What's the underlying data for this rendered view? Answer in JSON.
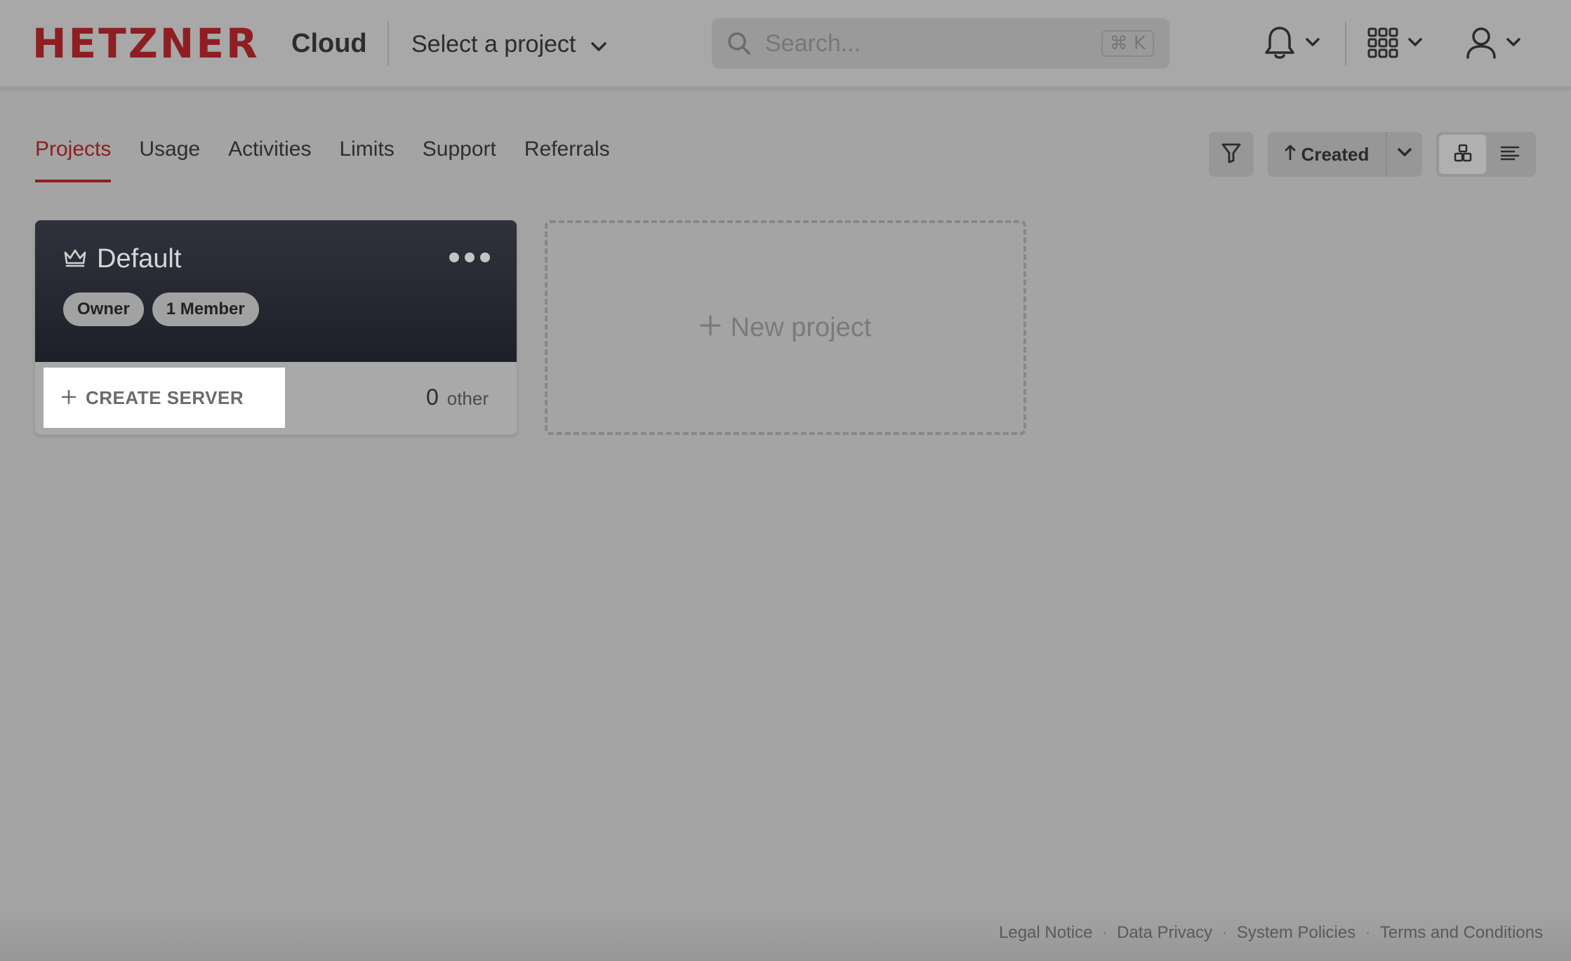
{
  "header": {
    "brand": "HETZNER",
    "product": "Cloud",
    "project_select_label": "Select a project",
    "search": {
      "placeholder": "Search...",
      "shortcut": "⌘ K"
    },
    "icons": [
      "bell-icon",
      "apps-grid-icon",
      "user-icon"
    ]
  },
  "nav": {
    "tabs": [
      {
        "label": "Projects",
        "active": true
      },
      {
        "label": "Usage"
      },
      {
        "label": "Activities"
      },
      {
        "label": "Limits"
      },
      {
        "label": "Support"
      },
      {
        "label": "Referrals"
      }
    ]
  },
  "toolbar": {
    "sort_label": "Created",
    "sort_direction_icon": "arrow-up",
    "views": [
      "grid",
      "list"
    ],
    "active_view": "grid"
  },
  "projects": [
    {
      "name": "Default",
      "badges": [
        "Owner",
        "1 Member"
      ],
      "create_server_label": "CREATE SERVER",
      "other_count": "0",
      "other_label": "other"
    }
  ],
  "new_project_label": "New project",
  "footer": {
    "links": [
      "Legal Notice",
      "Data Privacy",
      "System Policies",
      "Terms and Conditions"
    ],
    "separator": "·"
  },
  "colors": {
    "brand_red": "#8e1e22",
    "card_dark": "#1e2029",
    "overlay_gray": "#a4a4a4"
  }
}
